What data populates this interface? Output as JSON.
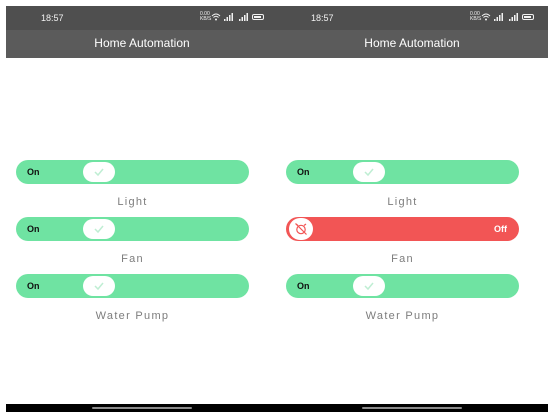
{
  "screens": [
    {
      "status_time": "18:57",
      "speed": "0.00 KB/S",
      "app_title": "Home Automation",
      "devices": [
        {
          "name": "Light",
          "state": "On",
          "on": true
        },
        {
          "name": "Fan",
          "state": "On",
          "on": true
        },
        {
          "name": "Water Pump",
          "state": "On",
          "on": true
        }
      ]
    },
    {
      "status_time": "18:57",
      "speed": "0.00 KB/S",
      "app_title": "Home Automation",
      "devices": [
        {
          "name": "Light",
          "state": "On",
          "on": true
        },
        {
          "name": "Fan",
          "state": "Off",
          "on": false
        },
        {
          "name": "Water Pump",
          "state": "On",
          "on": true
        }
      ]
    }
  ],
  "colors": {
    "on": "#6fe3a2",
    "off": "#f25555",
    "app_bar": "#5b5b5b",
    "status_bar": "#4f4f4f"
  },
  "icons": {
    "status": [
      "wifi-icon",
      "signal-icon",
      "battery-icon"
    ],
    "on_knob": "check-icon",
    "off_knob": "alarm-off-icon"
  }
}
